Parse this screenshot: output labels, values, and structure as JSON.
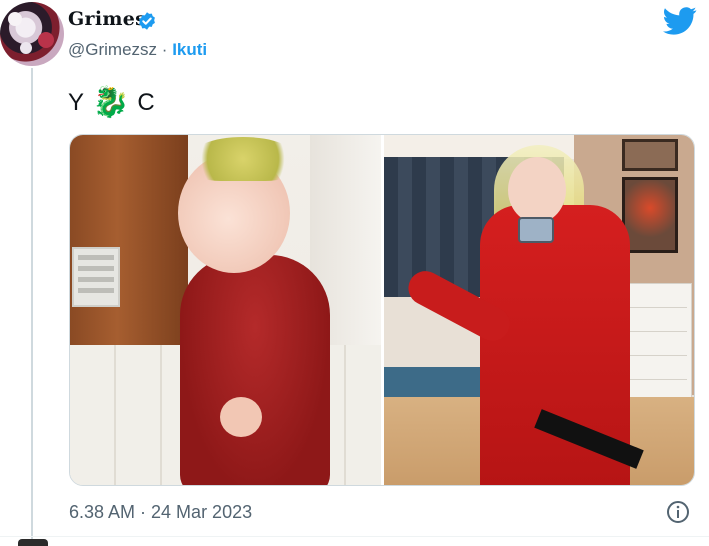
{
  "tweet": {
    "author_name": "Grimes",
    "handle": "@Grimezsz",
    "separator": "·",
    "follow_label": "Ikuti",
    "text_left": "Y",
    "text_emoji": "🐉",
    "text_right": "C",
    "timestamp": "6.38 AM · 24 Mar 2023"
  },
  "icons": {
    "verified": "verified-badge-icon",
    "brand": "twitter-bird-icon",
    "info": "info-icon"
  },
  "colors": {
    "accent": "#1d9bf0",
    "secondary_text": "#536471",
    "primary_text": "#0f1419"
  }
}
